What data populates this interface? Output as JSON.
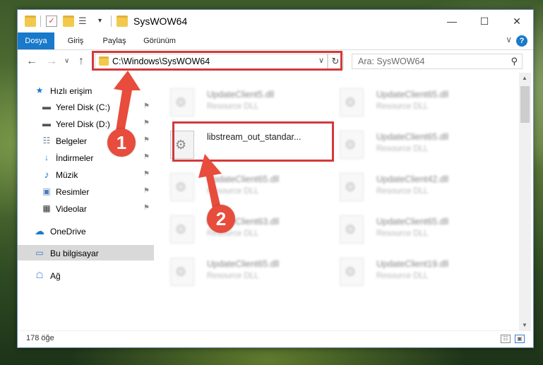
{
  "window": {
    "title": "SysWOW64",
    "minimize": "—",
    "maximize": "☐",
    "close": "✕"
  },
  "ribbon": {
    "tabs": [
      {
        "label": "Dosya",
        "active": true
      },
      {
        "label": "Giriş"
      },
      {
        "label": "Paylaş"
      },
      {
        "label": "Görünüm"
      }
    ],
    "help": "?",
    "collapse": "∨"
  },
  "nav": {
    "back": "←",
    "forward": "→",
    "recent": "∨",
    "up": "↑",
    "address": "C:\\Windows\\SysWOW64",
    "address_dropdown": "∨",
    "refresh": "↻",
    "search_placeholder": "Ara: SysWOW64",
    "search_icon": "⚲"
  },
  "sidebar": {
    "items": [
      {
        "label": "Hızlı erişim",
        "icon": "star-icon",
        "glyph": "★",
        "color": "#1979ca",
        "pinned": false
      },
      {
        "label": "Yerel Disk (C:)",
        "icon": "drive-icon",
        "glyph": "▬",
        "color": "#555555",
        "pinned": true
      },
      {
        "label": "Yerel Disk (D:)",
        "icon": "drive-icon",
        "glyph": "▬",
        "color": "#555555",
        "pinned": true
      },
      {
        "label": "Belgeler",
        "icon": "documents-icon",
        "glyph": "☷",
        "color": "#6b7f96",
        "pinned": true
      },
      {
        "label": "İndirmeler",
        "icon": "download-icon",
        "glyph": "↓",
        "color": "#1979ca",
        "pinned": true
      },
      {
        "label": "Müzik",
        "icon": "music-icon",
        "glyph": "♪",
        "color": "#1979ca",
        "pinned": true
      },
      {
        "label": "Resimler",
        "icon": "pictures-icon",
        "glyph": "▣",
        "color": "#4a7fb5",
        "pinned": true
      },
      {
        "label": "Videolar",
        "icon": "video-icon",
        "glyph": "▦",
        "color": "#333333",
        "pinned": true
      },
      {
        "label": "OneDrive",
        "icon": "cloud-icon",
        "glyph": "☁",
        "color": "#1979ca",
        "pinned": false
      },
      {
        "label": "Bu bilgisayar",
        "icon": "computer-icon",
        "glyph": "▭",
        "color": "#3a7bc8",
        "pinned": false,
        "selected": true
      },
      {
        "label": "Ağ",
        "icon": "network-icon",
        "glyph": "☖",
        "color": "#3a7bc8",
        "pinned": false
      }
    ],
    "pin_glyph": "⚑"
  },
  "files": [
    {
      "name": "UpdateClient5.dll",
      "type": "Resource DLL",
      "blurred": true
    },
    {
      "name": "UpdateClient65.dll",
      "type": "Resource DLL",
      "blurred": true
    },
    {
      "name": "libstream_out_standar...",
      "type": "",
      "blurred": false
    },
    {
      "name": "UpdateClient65.dll",
      "type": "Resource DLL",
      "blurred": true
    },
    {
      "name": "UpdateClient65.dll",
      "type": "Resource DLL",
      "blurred": true
    },
    {
      "name": "UpdateClient42.dll",
      "type": "Resource DLL",
      "blurred": true
    },
    {
      "name": "UpdateClient63.dll",
      "type": "Resource DLL",
      "blurred": true
    },
    {
      "name": "UpdateClient65.dll",
      "type": "Resource DLL",
      "blurred": true
    },
    {
      "name": "UpdateClient65.dll",
      "type": "Resource DLL",
      "blurred": true
    },
    {
      "name": "UpdateClient19.dll",
      "type": "Resource DLL",
      "blurred": true
    }
  ],
  "status": {
    "count": "178 öğe"
  },
  "annotations": {
    "step1": "1",
    "step2": "2",
    "color": "#e74c3c"
  }
}
